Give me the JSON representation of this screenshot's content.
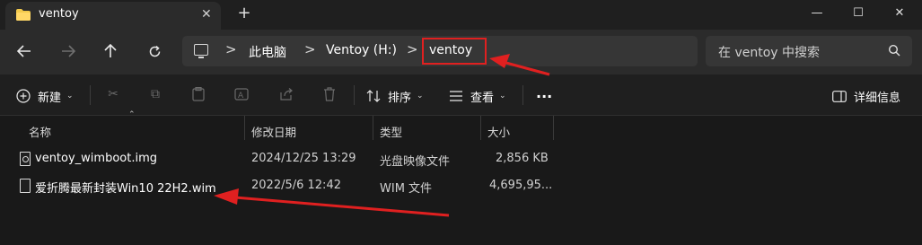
{
  "window": {
    "tab_title": "ventoy",
    "tab_close_icon": "close-icon",
    "new_tab_label": "+",
    "controls": {
      "minimize": "—",
      "maximize": "☐",
      "close": "✕"
    }
  },
  "nav": {
    "back_icon": "back-arrow-icon",
    "forward_icon": "forward-arrow-icon",
    "up_icon": "up-arrow-icon",
    "refresh_icon": "refresh-icon"
  },
  "address": {
    "separator": ">",
    "crumbs": [
      "此电脑",
      "Ventoy (H:)",
      "ventoy"
    ]
  },
  "search": {
    "placeholder": "在 ventoy 中搜索"
  },
  "toolbar": {
    "new_label": "新建",
    "sort_label": "排序",
    "view_label": "查看",
    "more_label": "···",
    "details_label": "详细信息"
  },
  "list": {
    "columns": [
      "名称",
      "修改日期",
      "类型",
      "大小"
    ],
    "rows": [
      {
        "name": "ventoy_wimboot.img",
        "modified": "2024/12/25 13:29",
        "type": "光盘映像文件",
        "size": "2,856 KB"
      },
      {
        "name": "爱折腾最新封装Win10 22H2.wim",
        "modified": "2022/5/6 12:42",
        "type": "WIM 文件",
        "size": "4,695,95..."
      }
    ]
  },
  "colors": {
    "background": "#191919",
    "nav_background": "#2b2b2b",
    "annotation_red": "#e02020",
    "folder_yellow": "#f2c94c"
  }
}
